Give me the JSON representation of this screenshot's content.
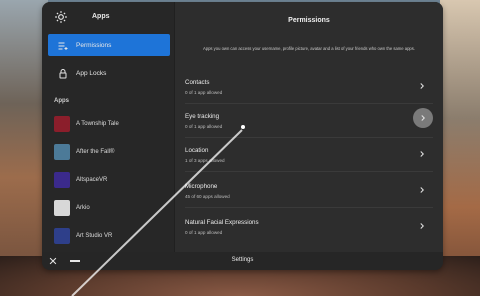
{
  "window": {
    "sidebar_title": "Apps",
    "nav": [
      {
        "label": "Permissions",
        "icon": "permissions-list-icon"
      },
      {
        "label": "App Locks",
        "icon": "lock-icon"
      }
    ],
    "apps_section_label": "Apps",
    "apps": [
      {
        "label": "A Township Tale",
        "thumb_color": "#8b1e2b"
      },
      {
        "label": "After the Fall®",
        "thumb_color": "#4c7a98"
      },
      {
        "label": "AltspaceVR",
        "thumb_color": "#3b2a8c"
      },
      {
        "label": "Arkio",
        "thumb_color": "#d8d8d8"
      },
      {
        "label": "Art Studio VR",
        "thumb_color": "#2e3f8a"
      }
    ]
  },
  "permissions": {
    "title": "Permissions",
    "description": "Apps you own can access your username, profile picture, avatar and a list of your friends who own the same apps.",
    "items": [
      {
        "name": "Contacts",
        "subtitle": "0 of 1 app allowed"
      },
      {
        "name": "Eye tracking",
        "subtitle": "0 of 1 app allowed"
      },
      {
        "name": "Location",
        "subtitle": "1 of 3 apps allowed"
      },
      {
        "name": "Microphone",
        "subtitle": "45 of 60 apps allowed"
      },
      {
        "name": "Natural Facial Expressions",
        "subtitle": "0 of 1 app allowed"
      }
    ]
  },
  "bottom_bar": {
    "title": "Settings"
  },
  "colors": {
    "accent": "#1e74d8",
    "panel": "#2b2b2b",
    "sidebar": "#272727"
  }
}
